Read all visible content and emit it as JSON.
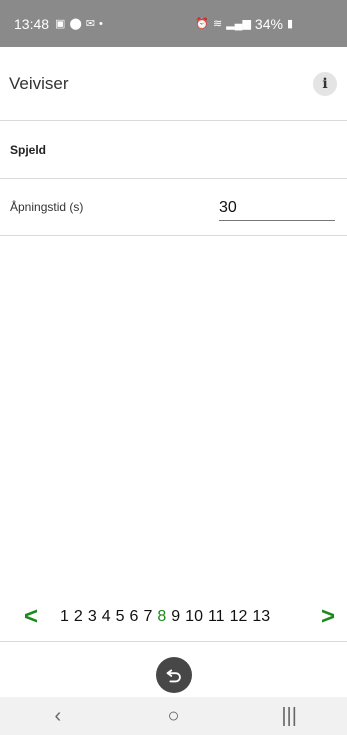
{
  "status": {
    "time": "13:48",
    "battery": "34%",
    "icons": [
      "image-icon",
      "location-icon",
      "notification-icon",
      "dot-icon",
      "alarm-icon",
      "wifi-icon",
      "signal-icon"
    ]
  },
  "appbar": {
    "title": "Veiviser",
    "info_label": "i"
  },
  "section": {
    "title": "Spjeld"
  },
  "field": {
    "label": "Åpningstid (s)",
    "value": "30"
  },
  "pager": {
    "prev": "<",
    "next": ">",
    "pages": [
      "1",
      "2",
      "3",
      "4",
      "5",
      "6",
      "7",
      "8",
      "9",
      "10",
      "11",
      "12",
      "13"
    ],
    "current": "8",
    "accent_color": "#1a8a1a"
  },
  "nav": {
    "back": "‹",
    "home": "○",
    "recents": "|||"
  }
}
